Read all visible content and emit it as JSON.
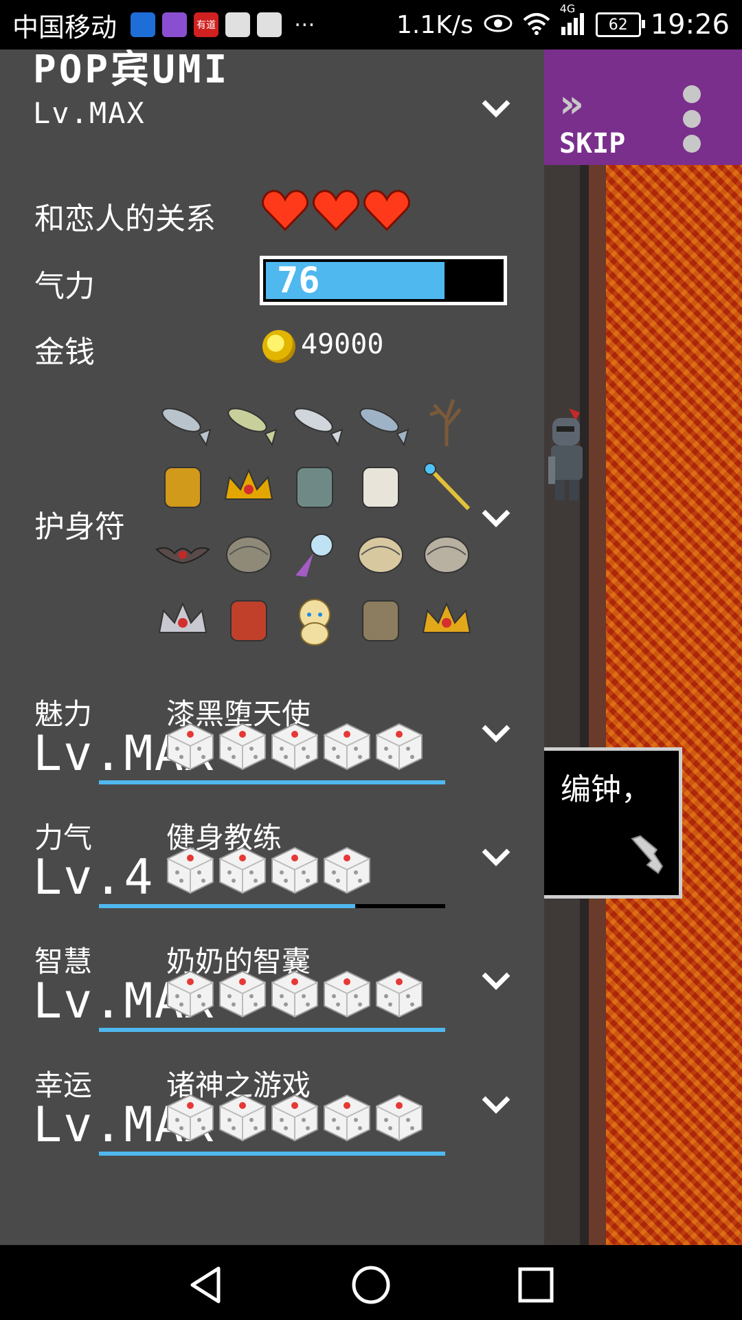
{
  "status_bar": {
    "carrier": "中国移动",
    "apps": [
      {
        "name": "wifi-app-icon",
        "color": "#1e6ed8"
      },
      {
        "name": "gallery-app-icon",
        "color": "#8a4fd0"
      },
      {
        "name": "youdao-app-icon",
        "color": "#d02020",
        "text": "有道"
      },
      {
        "name": "balloon-app-icon",
        "color": "#e0e0e0"
      },
      {
        "name": "baidu-app-icon",
        "color": "#e0e0e0"
      }
    ],
    "more": "···",
    "speed": "1.1K/s",
    "network": "4G",
    "battery": "62",
    "time": "19:26"
  },
  "character": {
    "name": "POP宾UMI",
    "level": "Lv.MAX"
  },
  "relationship": {
    "label": "和恋人的关系",
    "hearts": 3
  },
  "energy": {
    "label": "气力",
    "value": "76",
    "fraction": 0.76
  },
  "money": {
    "label": "金钱",
    "amount": "49000"
  },
  "charms": {
    "label": "护身符",
    "items": [
      "tuna-fish",
      "yellowfin-fish",
      "silver-fish",
      "blue-fish",
      "coral-branch",
      "golden-hammer",
      "crown",
      "bronze-bell",
      "white-horn",
      "jeweled-scepter",
      "bat",
      "clam-shell",
      "perfume-bottle",
      "ammonite-fossil",
      "oyster-shell",
      "silver-tiara",
      "red-lobster",
      "golden-puppy",
      "dinosaur-skull",
      "ruby-tiara"
    ]
  },
  "stats": [
    {
      "key": "charm",
      "label": "魅力",
      "title": "漆黑堕天使",
      "level": "Lv.MAX",
      "dice": 5,
      "progress": 1.0
    },
    {
      "key": "strength",
      "label": "力气",
      "title": "健身教练",
      "level": "Lv.4",
      "dice": 4,
      "progress": 0.74
    },
    {
      "key": "wisdom",
      "label": "智慧",
      "title": "奶奶的智囊",
      "level": "Lv.MAX",
      "dice": 5,
      "progress": 1.0
    },
    {
      "key": "luck",
      "label": "幸运",
      "title": "诸神之游戏",
      "level": "Lv.MAX",
      "dice": 5,
      "progress": 1.0
    }
  ],
  "game": {
    "skip_label": "SKIP",
    "dialog_text": "编钟，"
  },
  "colors": {
    "panel": "#4a4a4a",
    "accent_blue": "#4fb8ef",
    "topbar_purple": "#7a2f8c",
    "heart_red": "#ff3a1a"
  }
}
